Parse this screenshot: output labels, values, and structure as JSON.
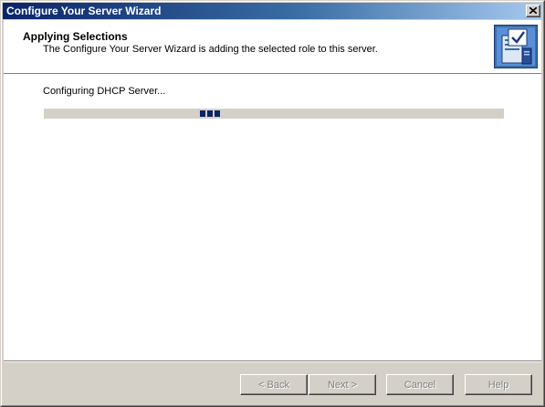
{
  "window": {
    "title": "Configure Your Server Wizard"
  },
  "header": {
    "title": "Applying Selections",
    "subtitle": "The Configure Your Server Wizard is adding the selected role to this server.",
    "icon": "server-wizard-icon"
  },
  "main": {
    "status_text": "Configuring DHCP Server...",
    "progress": {
      "style": "marquee",
      "position_fraction": 0.34,
      "block_count": 3
    }
  },
  "footer": {
    "back_label": "< Back",
    "next_label": "Next >",
    "cancel_label": "Cancel",
    "help_label": "Help"
  },
  "colors": {
    "titlebar_start": "#0a246a",
    "titlebar_end": "#a6caf0",
    "progress_block": "#0a246a",
    "progress_track": "#d4d0c8",
    "dialog_face": "#d4d0c8"
  }
}
